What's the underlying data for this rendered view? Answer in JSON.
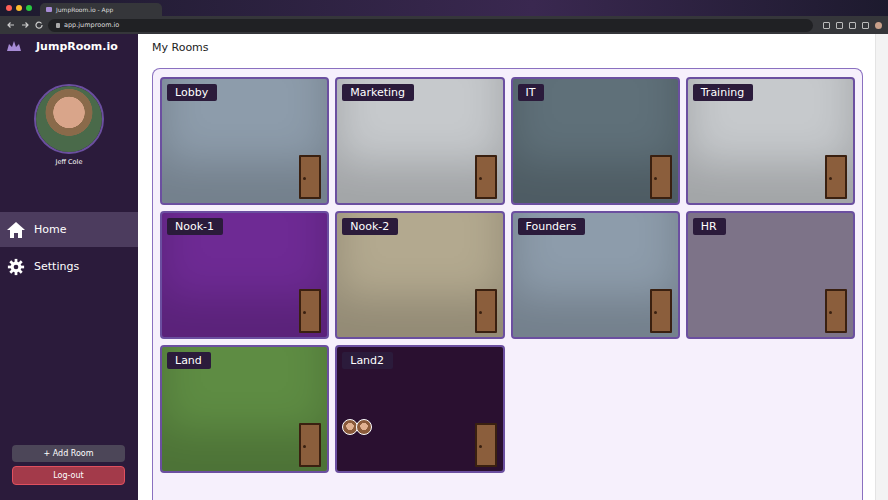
{
  "browser": {
    "tab_title": "JumpRoom.io - App",
    "url": "app.jumproom.io"
  },
  "sidebar": {
    "app_name": "JumpRoom.io",
    "user_name": "Jeff Cole",
    "items": [
      {
        "label": "Home",
        "icon": "home",
        "selected": true
      },
      {
        "label": "Settings",
        "icon": "gear",
        "selected": false
      }
    ],
    "buttons": [
      {
        "label": "+ Add Room",
        "kind": "add"
      },
      {
        "label": "Log-out",
        "kind": "logout"
      }
    ]
  },
  "page_title": "My Rooms",
  "rooms": [
    {
      "name": "Lobby",
      "kind": "photo",
      "color": "#8d9cab",
      "occupants": 0
    },
    {
      "name": "Marketing",
      "kind": "photo",
      "color": "#c6c9cc",
      "occupants": 0
    },
    {
      "name": "IT",
      "kind": "photo",
      "color": "#5f7079",
      "occupants": 0
    },
    {
      "name": "Training",
      "kind": "photo",
      "color": "#c6c9cc",
      "occupants": 0
    },
    {
      "name": "Nook-1",
      "kind": "photo",
      "color": "#6e2a94",
      "occupants": 0
    },
    {
      "name": "Nook-2",
      "kind": "photo",
      "color": "#b3a98f",
      "occupants": 0
    },
    {
      "name": "Founders",
      "kind": "photo",
      "color": "#8d9cab",
      "occupants": 0
    },
    {
      "name": "HR",
      "kind": "plain",
      "color": "#7d7388",
      "occupants": 0
    },
    {
      "name": "Land",
      "kind": "photo",
      "color": "#5e8c43",
      "occupants": 0
    },
    {
      "name": "Land2",
      "kind": "plain",
      "color": "#2a1030",
      "occupants": 2
    }
  ]
}
